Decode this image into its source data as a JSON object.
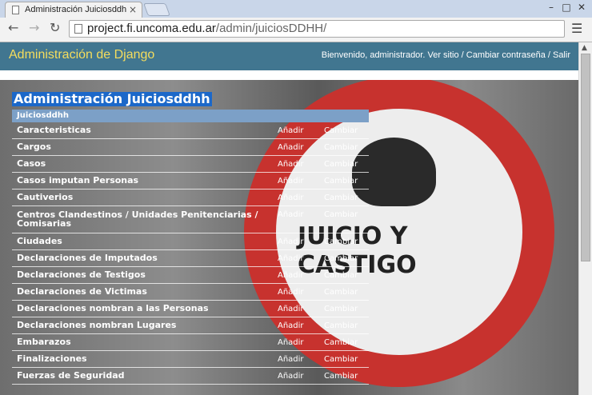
{
  "browser": {
    "tab_title": "Administración Juiciosddh",
    "tab_close": "×",
    "url_host": "project.fi.uncoma.edu.ar",
    "url_path": "/admin/juiciosDDHH/"
  },
  "header": {
    "branding": "Administración de Django",
    "user_tools": "Bienvenido, administrador. Ver sitio / Cambiar contraseña / Salir"
  },
  "page": {
    "title": "Administración Juiciosddhh"
  },
  "module": {
    "caption": "Juiciosddhh",
    "add_label": "Añadir",
    "change_label": "Cambiar",
    "rows": [
      {
        "label": "Caracteristicas"
      },
      {
        "label": "Cargos"
      },
      {
        "label": "Casos"
      },
      {
        "label": "Casos imputan Personas"
      },
      {
        "label": "Cautiverios"
      },
      {
        "label": "Centros Clandestinos / Unidades Penitenciarias / Comisarias"
      },
      {
        "label": "Ciudades"
      },
      {
        "label": "Declaraciones de Imputados"
      },
      {
        "label": "Declaraciones de Testigos"
      },
      {
        "label": "Declaraciones de Victimas"
      },
      {
        "label": "Declaraciones nombran a las Personas"
      },
      {
        "label": "Declaraciones nombran Lugares"
      },
      {
        "label": "Embarazos"
      },
      {
        "label": "Finalizaciones"
      },
      {
        "label": "Fuerzas de Seguridad"
      }
    ]
  },
  "background": {
    "sign_text_line1": "JUICIO Y",
    "sign_text_line2": "CASTIGO"
  },
  "colors": {
    "header_bg": "#417690",
    "branding": "#f5dd5d",
    "caption_bg": "#7ca0c7",
    "title_highlight": "#1c68c9"
  }
}
